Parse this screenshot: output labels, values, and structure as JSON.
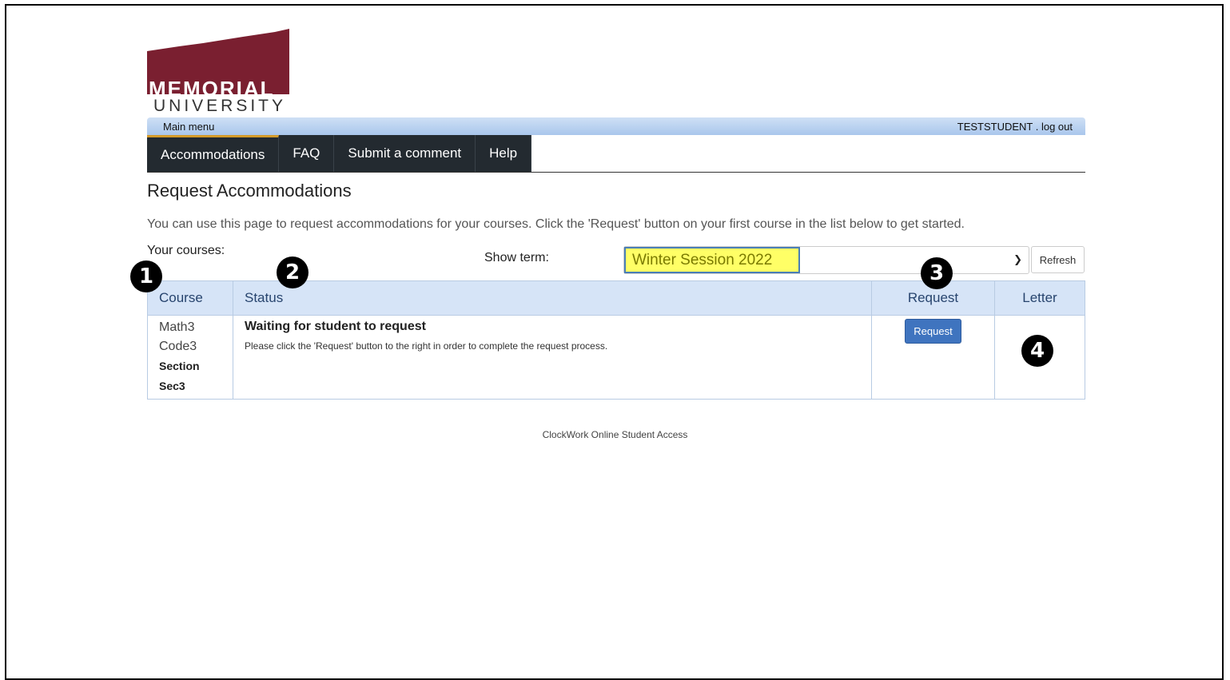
{
  "brand": {
    "logo_line1": "MEMORIAL",
    "logo_line2": "UNIVERSITY",
    "logo_color": "#7a1f30"
  },
  "topbar": {
    "main_menu": "Main menu",
    "user": "TESTSTUDENT . log out"
  },
  "nav": {
    "items": [
      "Accommodations",
      "FAQ",
      "Submit a comment",
      "Help"
    ],
    "active": "Accommodations"
  },
  "page": {
    "title": "Request Accommodations",
    "intro": "You can use this page to request accommodations for your courses. Click the 'Request' button on your first course in the list below to get started.",
    "your_courses_label": "Your courses:",
    "show_term_label": "Show term:",
    "term_value": "Winter Session 2022",
    "refresh_label": "Refresh"
  },
  "table": {
    "headers": [
      "Course",
      "Status",
      "Request",
      "Letter"
    ],
    "rows": [
      {
        "course_line1": "Math3",
        "course_line2": "Code3",
        "course_line3": "Section",
        "course_line4": "Sec3",
        "status_title": "Waiting for student to request",
        "status_desc": "Please click the 'Request' button to the right in order to complete the request process.",
        "request_button": "Request"
      }
    ]
  },
  "annotations": [
    "1",
    "2",
    "3",
    "4"
  ],
  "footer": "ClockWork Online Student Access"
}
